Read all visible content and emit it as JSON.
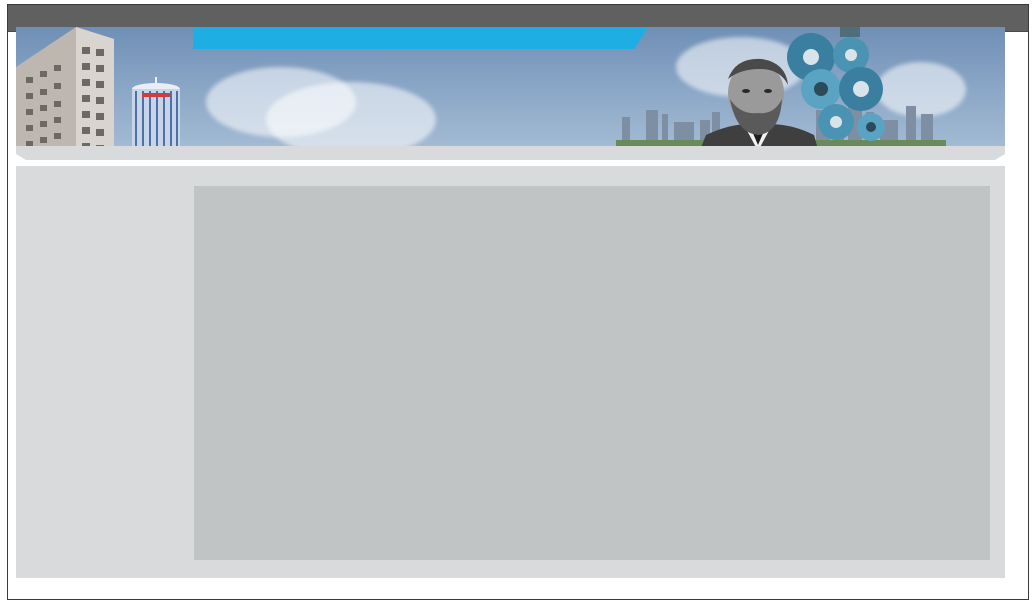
{
  "window": {
    "title": ""
  },
  "banner": {
    "accent_color": "#1eaee4",
    "images": [
      "office-building-image",
      "round-tower-image",
      "city-skyline-image",
      "bearded-man-portrait-image",
      "gear-machinery-image"
    ]
  },
  "colors": {
    "topbar": "#606060",
    "panel": "#d8dadb",
    "content": "#c0c4c4"
  }
}
